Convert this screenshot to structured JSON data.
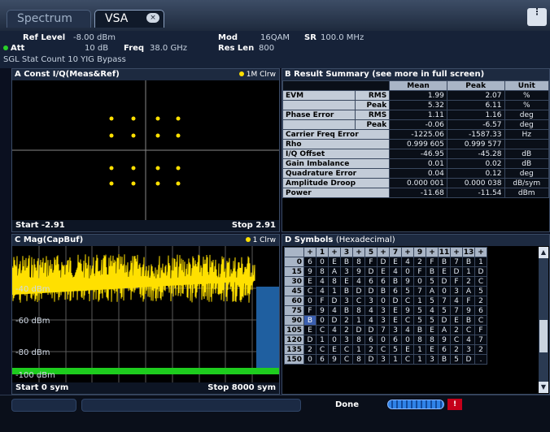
{
  "tabs": [
    {
      "label": "Spectrum"
    },
    {
      "label": "VSA"
    }
  ],
  "tab_close_icon": "×",
  "menu_icon": "⋮",
  "info": {
    "ref_level_label": "Ref Level",
    "ref_level_value": "-8.00 dBm",
    "att_label": "Att",
    "att_value": "10 dB",
    "freq_label": "Freq",
    "freq_value": "38.0 GHz",
    "mod_label": "Mod",
    "mod_value": "16QAM",
    "sr_label": "SR",
    "sr_value": "100.0 MHz",
    "reslen_label": "Res Len",
    "reslen_value": "800",
    "line3": "SGL Stat Count 10 YIG Bypass"
  },
  "const_panel": {
    "title": "A Const I/Q(Meas&Ref)",
    "trace": "1M Clrw",
    "start": "Start -2.91",
    "stop": "Stop 2.91"
  },
  "mag_panel": {
    "title": "C Mag(CapBuf)",
    "trace": "1 Clrw",
    "start": "Start 0 sym",
    "stop": "Stop 8000 sym",
    "levels": [
      "-40 dBm",
      "-60 dBm",
      "-80 dBm",
      "-100 dBm"
    ]
  },
  "result_panel": {
    "title": "B Result Summary (see more in full screen)",
    "headers": [
      "Mean",
      "Peak",
      "Unit"
    ],
    "rows": [
      {
        "l1": "EVM",
        "l2": "RMS",
        "mean": "1.99",
        "peak": "2.07",
        "unit": "%"
      },
      {
        "l1": "",
        "l2": "Peak",
        "mean": "5.32",
        "peak": "6.11",
        "unit": "%"
      },
      {
        "l1": "Phase Error",
        "l2": "RMS",
        "mean": "1.11",
        "peak": "1.16",
        "unit": "deg"
      },
      {
        "l1": "",
        "l2": "Peak",
        "mean": "-0.06",
        "peak": "-6.57",
        "unit": "deg"
      },
      {
        "l1": "Carrier Freq Error",
        "l2": "",
        "mean": "-1225.06",
        "peak": "-1587.33",
        "unit": "Hz"
      },
      {
        "l1": "Rho",
        "l2": "",
        "mean": "0.999 605",
        "peak": "0.999 577",
        "unit": ""
      },
      {
        "l1": "I/Q Offset",
        "l2": "",
        "mean": "-46.95",
        "peak": "-45.28",
        "unit": "dB"
      },
      {
        "l1": "Gain Imbalance",
        "l2": "",
        "mean": "0.01",
        "peak": "0.02",
        "unit": "dB"
      },
      {
        "l1": "Quadrature Error",
        "l2": "",
        "mean": "0.04",
        "peak": "0.12",
        "unit": "deg"
      },
      {
        "l1": "Amplitude Droop",
        "l2": "",
        "mean": "0.000 001",
        "peak": "0.000 038",
        "unit": "dB/sym"
      },
      {
        "l1": "Power",
        "l2": "",
        "mean": "-11.68",
        "peak": "-11.54",
        "unit": "dBm"
      }
    ]
  },
  "symbols_panel": {
    "title": "D Symbols",
    "subtitle": "(Hexadecimal)",
    "col_headers": [
      "+",
      "1",
      "+",
      "3",
      "+",
      "5",
      "+",
      "7",
      "+",
      "9",
      "+",
      "11",
      "+",
      "13",
      "+"
    ],
    "rows": [
      {
        "idx": "0",
        "vals": [
          "6",
          "0",
          "E",
          "B",
          "8",
          "F",
          "D",
          "E",
          "4",
          "2",
          "F",
          "B",
          "7",
          "B",
          "1"
        ]
      },
      {
        "idx": "15",
        "vals": [
          "9",
          "8",
          "A",
          "3",
          "9",
          "D",
          "E",
          "4",
          "0",
          "F",
          "B",
          "E",
          "D",
          "1",
          "D"
        ]
      },
      {
        "idx": "30",
        "vals": [
          "E",
          "4",
          "8",
          "E",
          "4",
          "6",
          "6",
          "B",
          "9",
          "0",
          "5",
          "D",
          "F",
          "2",
          "C"
        ]
      },
      {
        "idx": "45",
        "vals": [
          "C",
          "4",
          "1",
          "B",
          "D",
          "D",
          "B",
          "6",
          "5",
          "7",
          "A",
          "0",
          "3",
          "A",
          "5"
        ]
      },
      {
        "idx": "60",
        "vals": [
          "0",
          "F",
          "D",
          "3",
          "C",
          "3",
          "0",
          "D",
          "C",
          "1",
          "5",
          "7",
          "4",
          "F",
          "2"
        ]
      },
      {
        "idx": "75",
        "vals": [
          "F",
          "9",
          "4",
          "B",
          "8",
          "4",
          "3",
          "E",
          "9",
          "5",
          "4",
          "5",
          "7",
          "9",
          "6"
        ]
      },
      {
        "idx": "90",
        "vals": [
          "B",
          "0",
          "D",
          "2",
          "1",
          "4",
          "3",
          "E",
          "C",
          "5",
          "5",
          "D",
          "E",
          "B",
          "C"
        ]
      },
      {
        "idx": "105",
        "vals": [
          "E",
          "C",
          "4",
          "2",
          "D",
          "D",
          "7",
          "3",
          "4",
          "B",
          "E",
          "A",
          "2",
          "C",
          "F"
        ]
      },
      {
        "idx": "120",
        "vals": [
          "D",
          "1",
          "0",
          "3",
          "8",
          "6",
          "0",
          "6",
          "0",
          "8",
          "8",
          "9",
          "C",
          "4",
          "7"
        ]
      },
      {
        "idx": "135",
        "vals": [
          "2",
          "C",
          "E",
          "C",
          "1",
          "2",
          "C",
          "5",
          "E",
          "1",
          "E",
          "6",
          "2",
          "3",
          "2"
        ]
      },
      {
        "idx": "150",
        "vals": [
          "0",
          "6",
          "9",
          "C",
          "8",
          "D",
          "3",
          "1",
          "C",
          "1",
          "3",
          "B",
          "5",
          "D",
          "."
        ]
      }
    ]
  },
  "status": {
    "done": "Done",
    "error_icon": "error-x-icon",
    "err_text": "!"
  }
}
